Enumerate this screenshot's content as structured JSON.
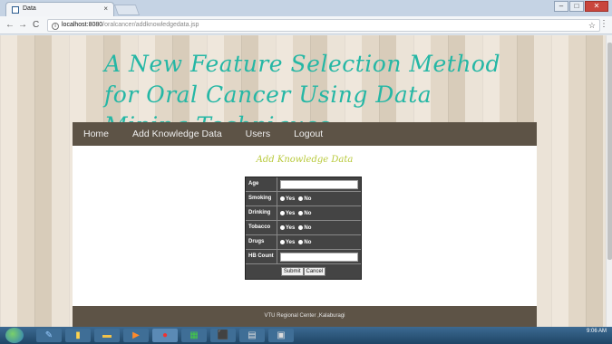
{
  "browser": {
    "tab_title": "Data",
    "tab_close": "×",
    "url_host": "localhost:8080",
    "url_path": "/oralcancer/addknowledgedata.jsp",
    "back": "←",
    "forward": "→",
    "reload": "C",
    "info_icon": "i",
    "star": "☆",
    "menu": "⋮",
    "window_controls": {
      "minimize": "–",
      "maximize": "□",
      "close": "✕"
    }
  },
  "site": {
    "title": "A New Feature Selection Method for Oral Cancer Using Data Mining Techniques"
  },
  "menu": {
    "items": [
      "Home",
      "Add Knowledge Data",
      "Users",
      "Logout"
    ]
  },
  "form": {
    "heading": "Add Knowledge Data",
    "age_label": "Age",
    "smoking_label": "Smoking",
    "drinking_label": "Drinking",
    "tobacco_label": "Tobacco",
    "drugs_label": "Drugs",
    "hb_label": "HB Count",
    "yes": "Yes",
    "no": "No",
    "age_value": "",
    "hb_value": "",
    "submit_label": "Submit",
    "cancel_label": "Cancel"
  },
  "footer": {
    "text": "VTU Regional Center ,Kalaburagi"
  },
  "taskbar": {
    "time": "9:06 AM"
  },
  "colors": {
    "title": "#25b7a5",
    "menubar": "#5d5346",
    "heading": "#b8c93a",
    "form_bg": "#444444"
  }
}
